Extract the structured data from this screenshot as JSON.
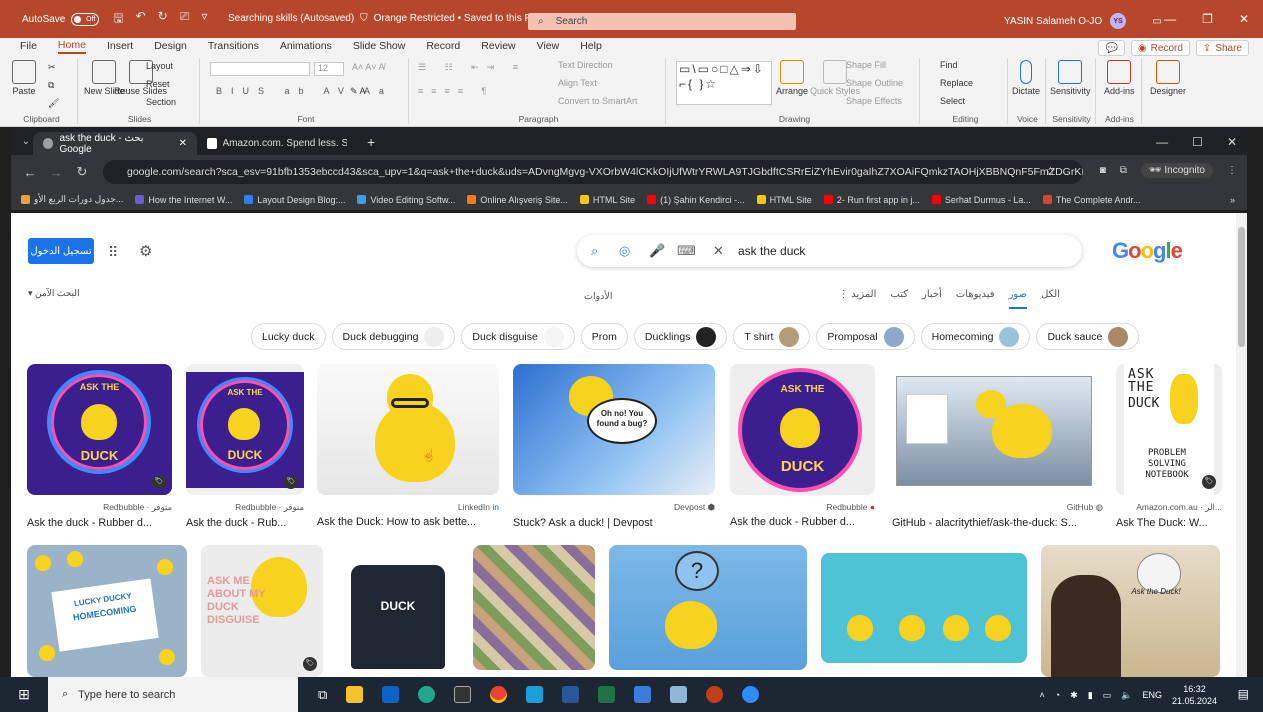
{
  "ppt": {
    "autosave_label": "AutoSave",
    "autosave_state": "Off",
    "doc_title": "Searching skills (Autosaved)",
    "sensitivity": "Orange Restricted • Saved to this PC",
    "search_placeholder": "Search",
    "user_name": "YASIN Salameh O-JO",
    "user_initials": "YS",
    "accent": "#b7472a"
  },
  "ribbon": {
    "tabs": [
      "File",
      "Home",
      "Insert",
      "Design",
      "Transitions",
      "Animations",
      "Slide Show",
      "Record",
      "Review",
      "View",
      "Help"
    ],
    "record_btn": "Record",
    "share_btn": "Share",
    "clipboard": {
      "paste": "Paste",
      "label": "Clipboard"
    },
    "slides": {
      "new_slide": "New Slide",
      "reuse": "Reuse Slides",
      "layout": "Layout",
      "reset": "Reset",
      "section": "Section",
      "label": "Slides"
    },
    "font": {
      "size": "12",
      "label": "Font"
    },
    "paragraph": {
      "text_direction": "Text Direction",
      "align_text": "Align Text",
      "smartart": "Convert to SmartArt",
      "label": "Paragraph"
    },
    "drawing": {
      "arrange": "Arrange",
      "quick_styles": "Quick Styles",
      "shape_fill": "Shape Fill",
      "shape_outline": "Shape Outline",
      "shape_effects": "Shape Effects",
      "label": "Drawing"
    },
    "editing": {
      "find": "Find",
      "replace": "Replace",
      "select": "Select",
      "label": "Editing"
    },
    "voice": {
      "dictate": "Dictate",
      "label": "Voice"
    },
    "sens": {
      "sensitivity": "Sensitivity",
      "label": "Sensitivity"
    },
    "addins": {
      "addins": "Add-ins",
      "label": "Add-ins"
    },
    "designer": {
      "designer": "Designer"
    }
  },
  "chrome": {
    "tabs": [
      {
        "title": "ask the duck - بحث Google"
      },
      {
        "title": "Amazon.com. Spend less. Smile"
      }
    ],
    "url": "google.com/search?sca_esv=91bfb1353ebccd43&sca_upv=1&q=ask+the+duck&uds=ADvngMgvg-VXOrbW4lCKkOIjUfWtrYRWLA9TJGbdftCSRrEiZYhEvir0gaIhZ7XOAiFQmkzTAOHjXBBNQnF5FmZDGrKL...",
    "incognito": "Incognito",
    "bookmarks": [
      "جدول دورات الربع الأو...",
      "How the Internet W...",
      "Layout Design Blog:...",
      "Video Editing Softw...",
      "Online Alışveriş Site...",
      "HTML Site",
      "(1) Şahin Kendirci -...",
      "HTML Site",
      "2- Run first app in j...",
      "Serhat Durmus - La...",
      "The Complete Andr..."
    ]
  },
  "google": {
    "signin": "تسجيل الدخول",
    "query": "ask the duck",
    "safe_search": "البحث الآمن",
    "tools": "الأدوات",
    "tabs": [
      "الكل",
      "صور",
      "فيديوهات",
      "أخبار",
      "كتب",
      "المزيد"
    ],
    "active_tab": "صور",
    "chips": [
      "Lucky duck",
      "Duck debugging",
      "Duck disguise",
      "Prom",
      "Ducklings",
      "T shirt",
      "Promposal",
      "Homecoming",
      "Duck sauce"
    ],
    "row1": [
      {
        "source": "Redbubble · متوفر",
        "title": "Ask the duck - Rubber d..."
      },
      {
        "source": "Redbubble · متوفر",
        "title": "Ask the duck - Rub..."
      },
      {
        "source": "LinkedIn",
        "title": "Ask the Duck: How to ask bette..."
      },
      {
        "source": "Devpost",
        "title": "Stuck? Ask a duck! | Devpost"
      },
      {
        "source": "Redbubble",
        "title": "Ask the duck - Rubber d..."
      },
      {
        "source": "GitHub",
        "title": "GitHub - alacritythief/ask-the-duck: S..."
      },
      {
        "source": "Amazon.com.au · الر...",
        "title": "Ask The Duck: W..."
      }
    ],
    "img_text": {
      "ask_the": "ASK THE",
      "duck": "DUCK",
      "bubble": "Oh no! You found a bug?",
      "notebook": "PROBLEM SOLVING NOTEBOOK",
      "lucky": "LUCKY DUCKY",
      "homecoming": "HOMECOMING",
      "ask_me": "ASK ME ABOUT MY DUCK DISGUISE",
      "shirt": "DUCK",
      "q": "?",
      "ask_duck2": "Ask the Duck!"
    }
  },
  "taskbar": {
    "search_placeholder": "Type here to search",
    "lang": "ENG",
    "time": "16:32",
    "date": "21.05.2024"
  }
}
